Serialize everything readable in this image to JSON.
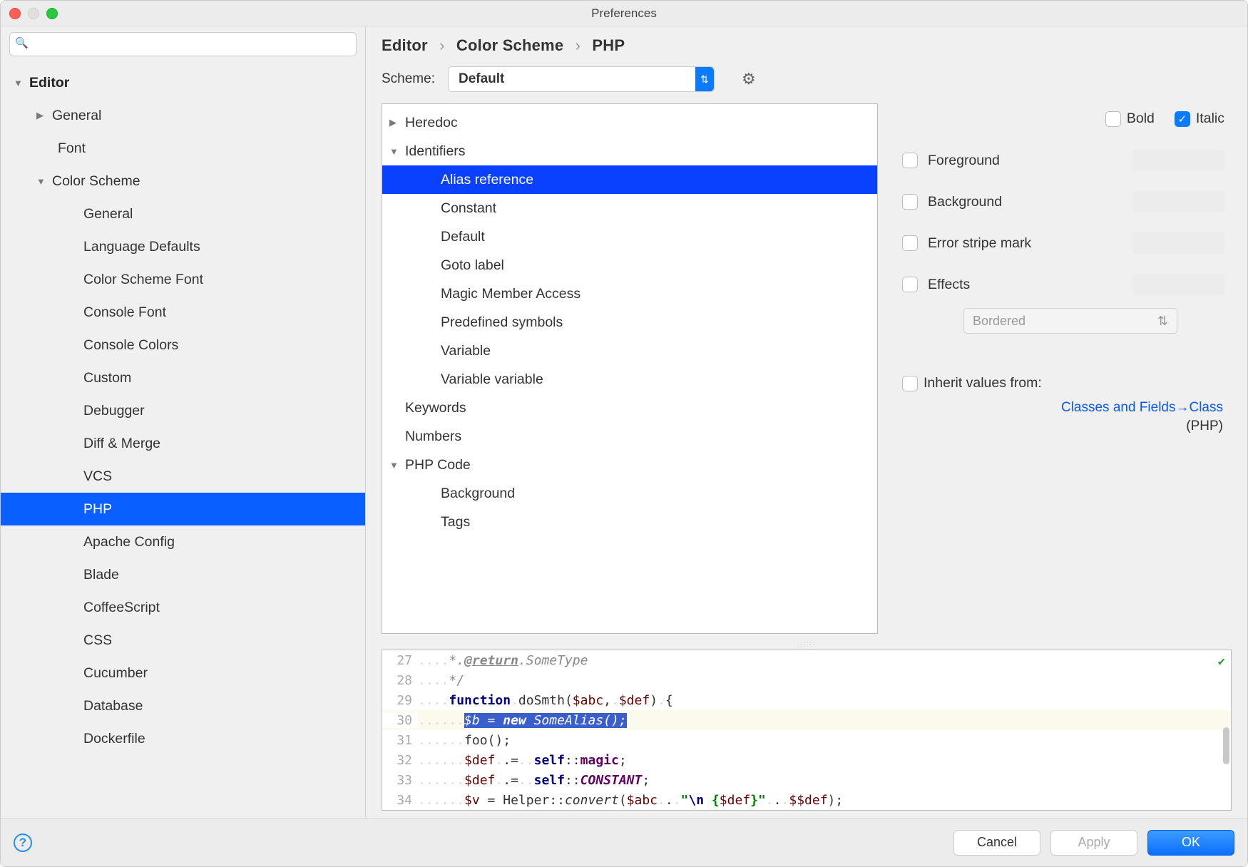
{
  "window": {
    "title": "Preferences"
  },
  "search": {
    "placeholder": ""
  },
  "sidebar": {
    "editor": "Editor",
    "general": "General",
    "font": "Font",
    "color_scheme": "Color Scheme",
    "items": [
      "General",
      "Language Defaults",
      "Color Scheme Font",
      "Console Font",
      "Console Colors",
      "Custom",
      "Debugger",
      "Diff & Merge",
      "VCS",
      "PHP",
      "Apache Config",
      "Blade",
      "CoffeeScript",
      "CSS",
      "Cucumber",
      "Database",
      "Dockerfile"
    ]
  },
  "breadcrumbs": [
    "Editor",
    "Color Scheme",
    "PHP"
  ],
  "scheme": {
    "label": "Scheme:",
    "value": "Default"
  },
  "categories": [
    {
      "label": "Heredoc",
      "level": 0,
      "chev": "▶"
    },
    {
      "label": "Identifiers",
      "level": 0,
      "chev": "▼"
    },
    {
      "label": "Alias reference",
      "level": 1,
      "selected": true
    },
    {
      "label": "Constant",
      "level": 1
    },
    {
      "label": "Default",
      "level": 1
    },
    {
      "label": "Goto label",
      "level": 1
    },
    {
      "label": "Magic Member Access",
      "level": 1
    },
    {
      "label": "Predefined symbols",
      "level": 1
    },
    {
      "label": "Variable",
      "level": 1
    },
    {
      "label": "Variable variable",
      "level": 1
    },
    {
      "label": "Keywords",
      "level": 0,
      "chev": ""
    },
    {
      "label": "Numbers",
      "level": 0,
      "chev": ""
    },
    {
      "label": "PHP Code",
      "level": 0,
      "chev": "▼"
    },
    {
      "label": "Background",
      "level": 1
    },
    {
      "label": "Tags",
      "level": 1
    }
  ],
  "attrs": {
    "bold": "Bold",
    "italic": "Italic",
    "foreground": "Foreground",
    "background": "Background",
    "error_stripe": "Error stripe mark",
    "effects": "Effects",
    "effect_type": "Bordered",
    "inherit": "Inherit values from:",
    "inherit_link": "Classes and Fields→Class",
    "inherit_sub": "(PHP)"
  },
  "preview": {
    "lines": [
      27,
      28,
      29,
      30,
      31,
      32,
      33,
      34
    ],
    "l27_tag": "@return",
    "l27_type": "SomeType",
    "l29_fname": "doSmth",
    "l29_args": "$abc, $def",
    "l30_b": "$b",
    "l30_alias": "SomeAlias",
    "l31": "foo();",
    "l32_var": "$def",
    "l32_magic": "magic",
    "l33_var": "$def",
    "l33_const": "CONSTANT",
    "l34_v": "$v",
    "l34_helper": "Helper",
    "l34_m": "convert",
    "l34_abc": "$abc",
    "l34_str1": "\"\\n {",
    "l34_def": "$def",
    "l34_str2": "}\"",
    "l34_dd": "$$def"
  },
  "footer": {
    "cancel": "Cancel",
    "apply": "Apply",
    "ok": "OK"
  }
}
